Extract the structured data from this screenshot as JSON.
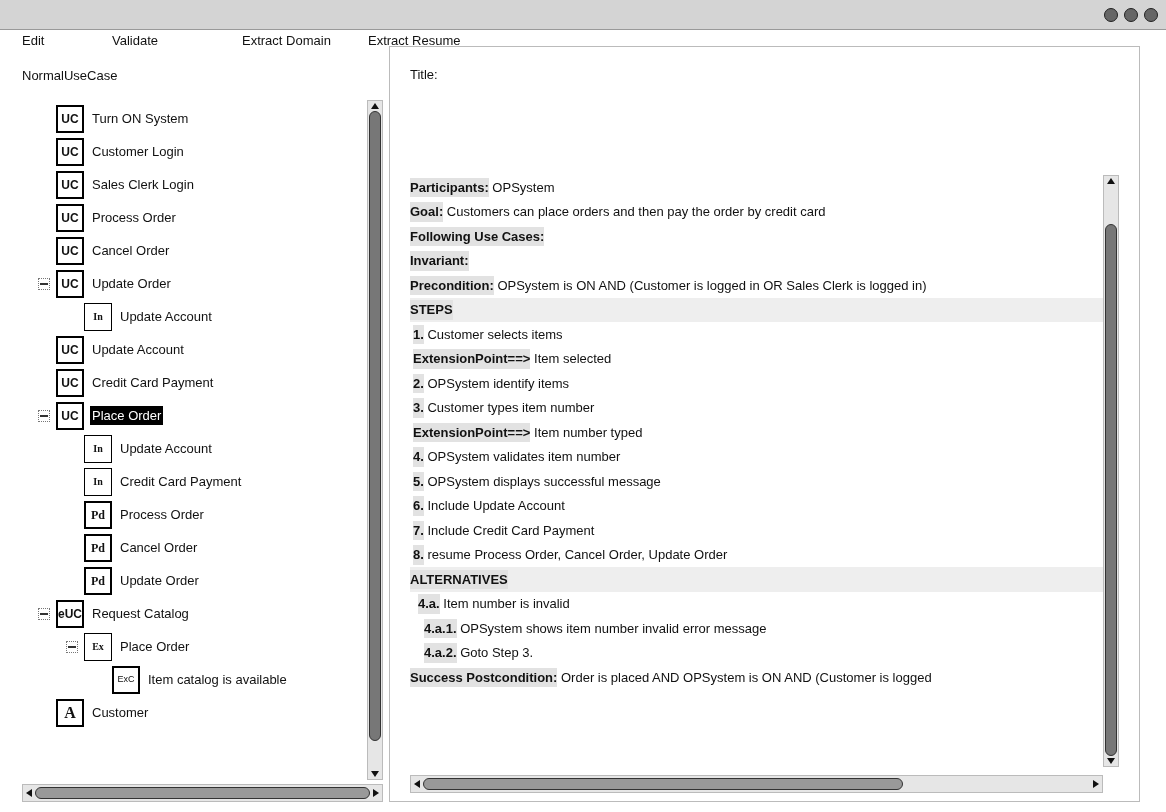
{
  "menu": [
    "Edit",
    "Validate",
    "Extract Domain",
    "Extract Resume"
  ],
  "tree": {
    "title": "NormalUseCase",
    "items": [
      {
        "badge": "UC",
        "kind": "usecase",
        "label": "Turn ON System",
        "selected": false
      },
      {
        "badge": "UC",
        "kind": "usecase",
        "label": "Customer Login",
        "selected": false
      },
      {
        "badge": "UC",
        "kind": "usecase",
        "label": "Sales Clerk Login",
        "selected": false
      },
      {
        "badge": "UC",
        "kind": "usecase",
        "label": "Process Order",
        "selected": false
      },
      {
        "badge": "UC",
        "kind": "usecase",
        "label": "Cancel Order",
        "selected": false
      },
      {
        "badge": "UC",
        "kind": "usecase",
        "label": "Update Order",
        "selected": false,
        "expanded": true,
        "children": [
          {
            "badge": "In",
            "kind": "include",
            "label": "Update Account",
            "selected": false
          }
        ]
      },
      {
        "badge": "UC",
        "kind": "usecase",
        "label": "Update Account",
        "selected": false
      },
      {
        "badge": "UC",
        "kind": "usecase",
        "label": "Credit Card Payment",
        "selected": false
      },
      {
        "badge": "UC",
        "kind": "usecase",
        "label": "Place Order",
        "selected": true,
        "expanded": true,
        "children": [
          {
            "badge": "In",
            "kind": "include",
            "label": "Update Account",
            "selected": false
          },
          {
            "badge": "In",
            "kind": "include",
            "label": "Credit Card Payment",
            "selected": false
          },
          {
            "badge": "Pd",
            "kind": "precedes",
            "label": "Process Order",
            "selected": false
          },
          {
            "badge": "Pd",
            "kind": "precedes",
            "label": "Cancel Order",
            "selected": false
          },
          {
            "badge": "Pd",
            "kind": "precedes",
            "label": "Update Order",
            "selected": false
          }
        ]
      },
      {
        "badge": "eUC",
        "kind": "usecase",
        "label": "Request Catalog",
        "selected": false,
        "expanded": true,
        "children": [
          {
            "badge": "Ex",
            "kind": "extend",
            "label": "Place Order",
            "selected": false,
            "expanded": true,
            "children": [
              {
                "badge": "ExC",
                "kind": "condition",
                "label": "Item catalog is available",
                "selected": false
              }
            ]
          }
        ]
      },
      {
        "badge": "A",
        "kind": "actor",
        "label": "Customer",
        "selected": false
      }
    ]
  },
  "detail": {
    "title_label": "Title:",
    "lines": [
      {
        "kind": "field",
        "label": "Participants:",
        "text": "OPSystem"
      },
      {
        "kind": "field",
        "label": "Goal:",
        "text": "Customers can place orders and then pay the order by credit card"
      },
      {
        "kind": "field",
        "label": "Following Use Cases:"
      },
      {
        "kind": "field",
        "label": "Invariant:"
      },
      {
        "kind": "field",
        "label": "Precondition:",
        "text": "OPSystem is ON AND (Customer is logged in OR Sales Clerk is logged in)"
      },
      {
        "kind": "section",
        "label": "STEPS"
      },
      {
        "kind": "step",
        "label": "1.",
        "text": "Customer selects items"
      },
      {
        "kind": "step",
        "label": "ExtensionPoint==>",
        "text": "Item selected"
      },
      {
        "kind": "step",
        "label": "2.",
        "text": "OPSystem identify items"
      },
      {
        "kind": "step",
        "label": "3.",
        "text": "Customer types item number"
      },
      {
        "kind": "step",
        "label": "ExtensionPoint==>",
        "text": "Item number typed"
      },
      {
        "kind": "step",
        "label": "4.",
        "text": "OPSystem validates item number"
      },
      {
        "kind": "step",
        "label": "5.",
        "text": "OPSystem displays successful message"
      },
      {
        "kind": "step",
        "label": "6.",
        "text": "Include Update Account"
      },
      {
        "kind": "step",
        "label": "7.",
        "text": "Include Credit Card Payment"
      },
      {
        "kind": "step",
        "label": "8.",
        "text": "resume Process Order, Cancel Order, Update Order"
      },
      {
        "kind": "section",
        "label": "ALTERNATIVES"
      },
      {
        "kind": "alt",
        "label": "4.a.",
        "text": "Item number is invalid"
      },
      {
        "kind": "subalt",
        "label": "4.a.1.",
        "text": "OPSystem shows item number invalid error message"
      },
      {
        "kind": "subalt",
        "label": "4.a.2.",
        "text": "Goto Step  3."
      },
      {
        "kind": "field",
        "label": "Success Postcondition:",
        "text": "Order is placed AND OPSystem is ON AND (Customer is logged"
      }
    ]
  }
}
